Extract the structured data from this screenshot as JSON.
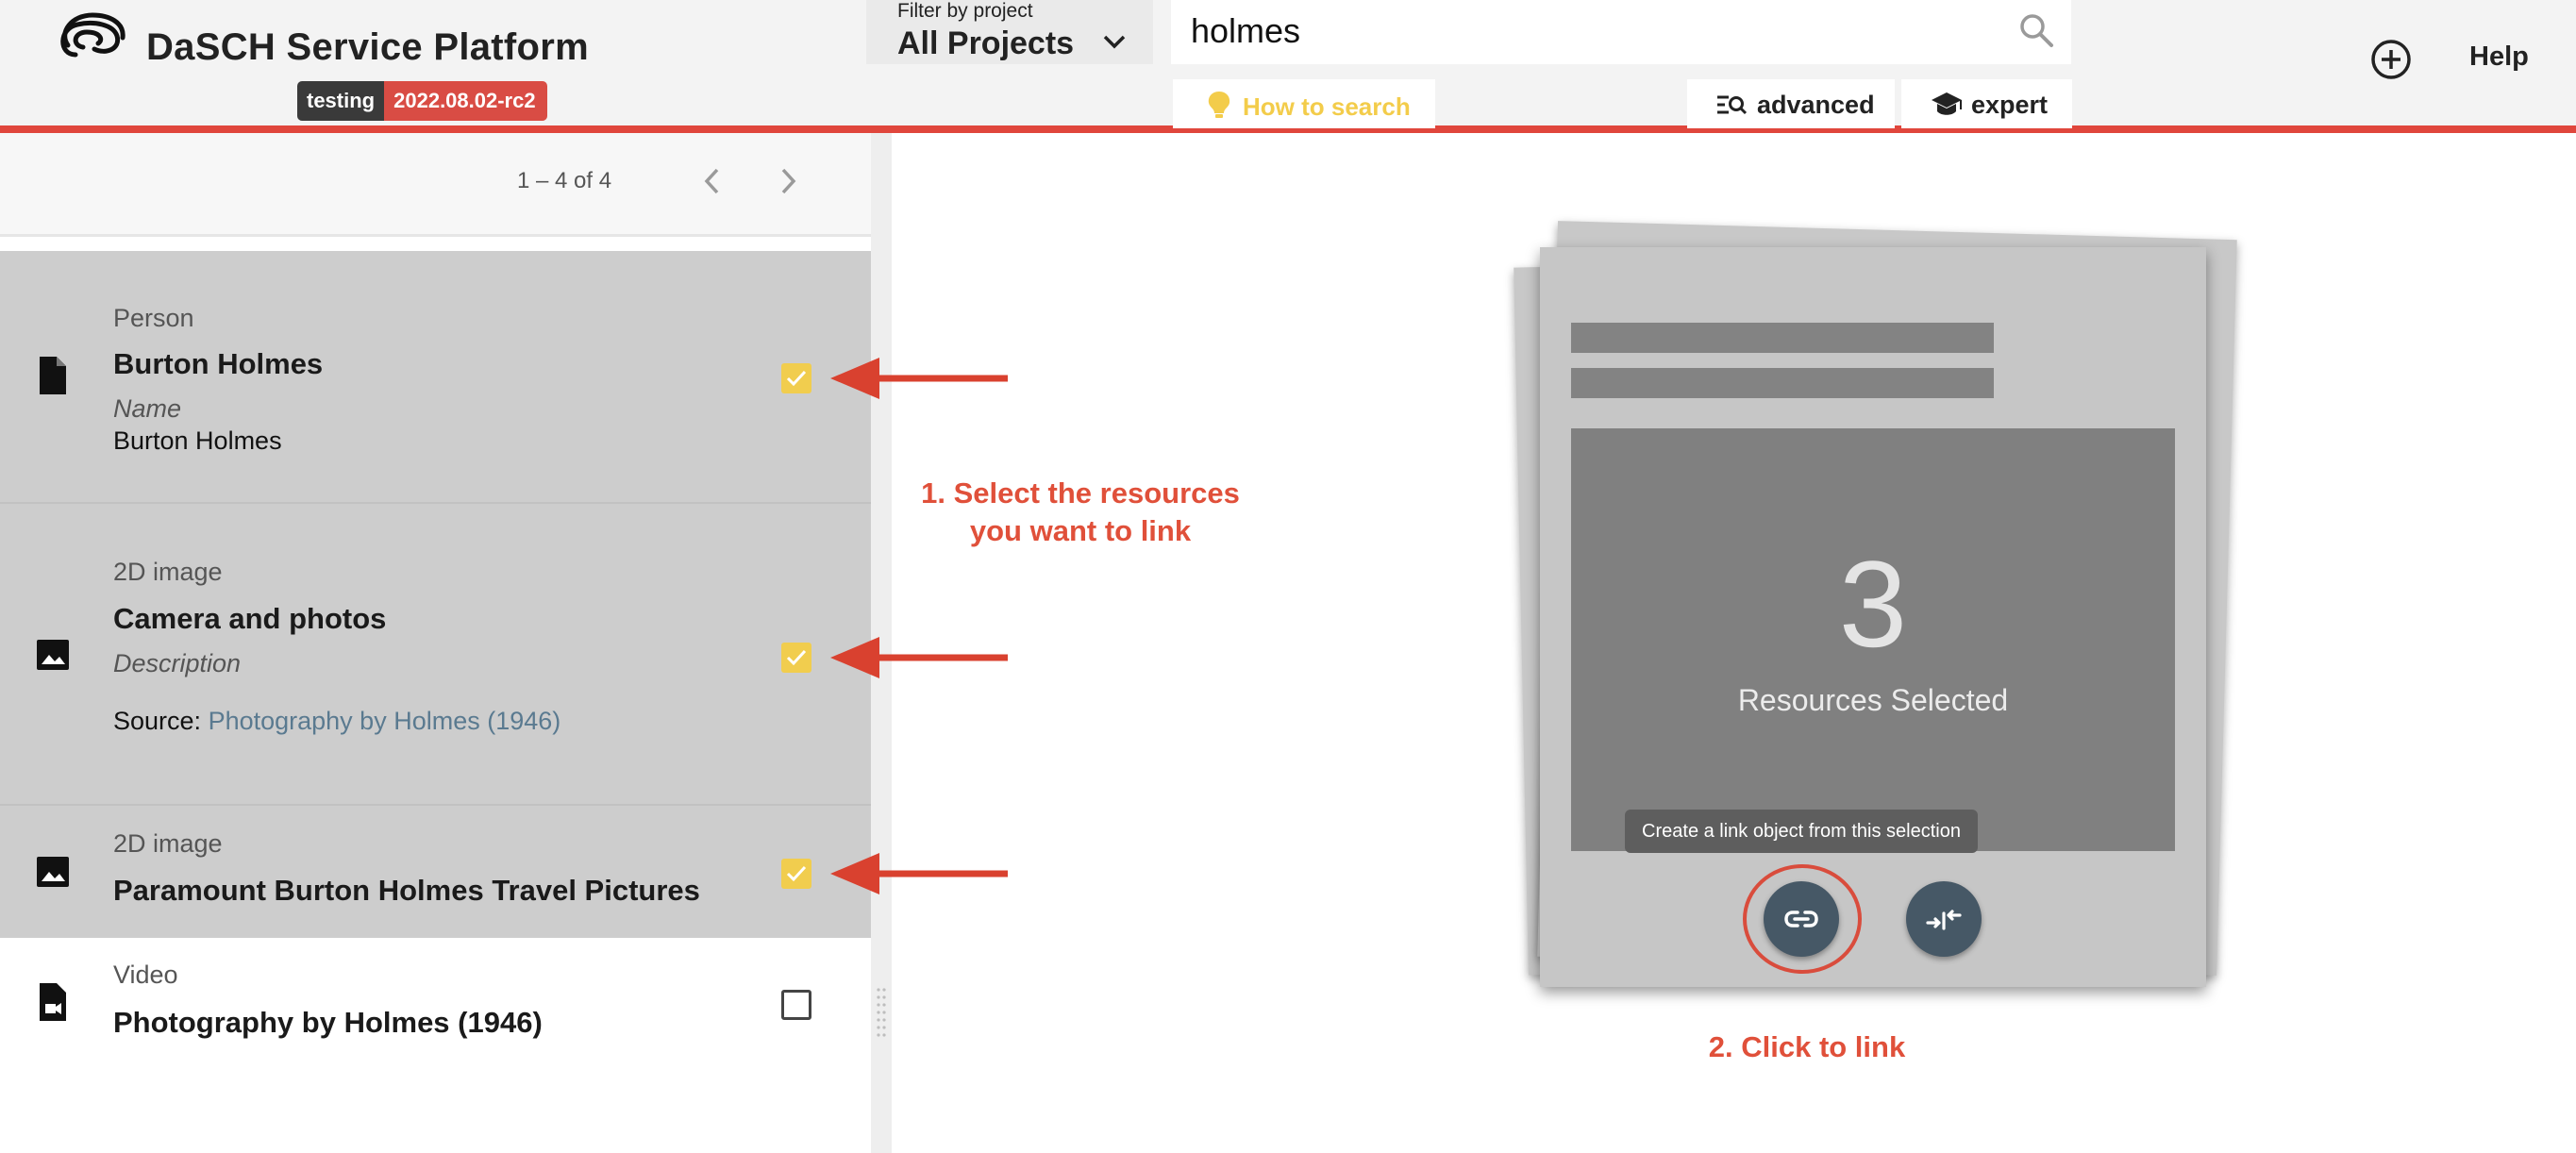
{
  "header": {
    "app_title": "DaSCH Service Platform",
    "env_label": "testing",
    "version_label": "2022.08.02-rc2",
    "filter_label": "Filter by project",
    "filter_value": "All Projects",
    "search_value": "holmes",
    "how_to_search": "How to search",
    "advanced_label": "advanced",
    "expert_label": "expert",
    "help_label": "Help",
    "colors": {
      "accent_line": "#e0463c",
      "badge_version": "#d94c44",
      "hint": "#f3cc4a"
    }
  },
  "pager": {
    "range_text": "1 – 4 of 4"
  },
  "results": [
    {
      "type": "Person",
      "title": "Burton Holmes",
      "prop_label": "Name",
      "prop_value": "Burton Holmes",
      "selected": true,
      "icon": "document-icon"
    },
    {
      "type": "2D image",
      "title": "Camera and photos",
      "prop_label": "Description",
      "source_prefix": "Source: ",
      "source_link": "Photography by Holmes (1946)",
      "selected": true,
      "icon": "image-icon"
    },
    {
      "type": "2D image",
      "title": "Paramount Burton Holmes Travel Pictures",
      "selected": true,
      "icon": "image-icon"
    },
    {
      "type": "Video",
      "title": "Photography by Holmes (1946)",
      "selected": false,
      "icon": "video-file-icon"
    }
  ],
  "annotations": {
    "step1_line1": "1. Select the resources",
    "step1_line2": "you want to link",
    "step2": "2. Click to link",
    "color": "#e0503a"
  },
  "comparison": {
    "count": "3",
    "count_label": "Resources Selected",
    "tooltip": "Create a link object from this selection",
    "link_button_icon": "link-icon",
    "compare_button_icon": "compare-arrows-icon"
  }
}
